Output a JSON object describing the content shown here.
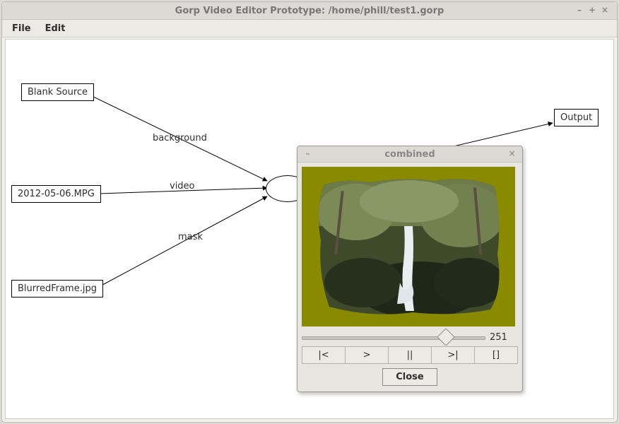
{
  "window": {
    "title": "Gorp Video Editor Prototype: /home/phill/test1.gorp",
    "buttons": {
      "min": "–",
      "max": "+",
      "close": "×"
    }
  },
  "menubar": {
    "file": "File",
    "edit": "Edit"
  },
  "graph": {
    "nodes": {
      "blank": "Blank Source",
      "mpg": "2012-05-06.MPG",
      "blur": "BlurredFrame.jpg",
      "output": "Output"
    },
    "edges": {
      "background": "background",
      "video": "video",
      "mask": "mask"
    }
  },
  "preview": {
    "title": "combined",
    "buttons": {
      "min": "–",
      "close": "×"
    },
    "frame": "251",
    "slider_pos_pct": 78,
    "controls": {
      "rewind": "|<",
      "play": ">",
      "pause": "||",
      "fwd": ">|",
      "stop": "[]"
    },
    "close": "Close"
  }
}
